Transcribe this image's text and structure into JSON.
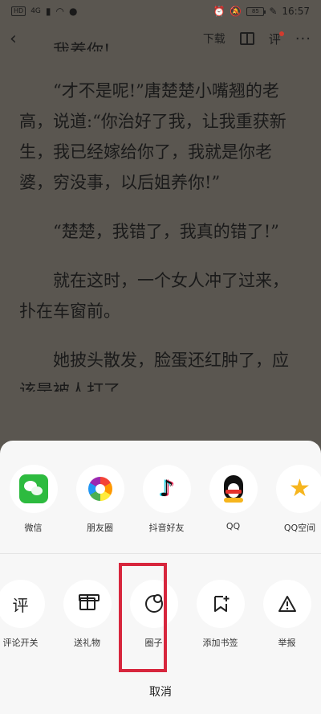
{
  "status_bar": {
    "left_badge": "HD",
    "signal": "4G",
    "battery": "85",
    "time": "16:57"
  },
  "toolbar": {
    "download_label": "下载",
    "comment_label": "评"
  },
  "content": {
    "top_fragment": "我养你!",
    "paragraphs": [
      "“才不是呢!”唐楚楚小嘴翘的老高，说道:“你治好了我，让我重获新生，我已经嫁给你了，我就是你老婆，穷没事，以后姐养你!”",
      "“楚楚，我错了，我真的错了!”",
      "就在这时，一个女人冲了过来，扑在车窗前。",
      "她披头散发，脸蛋还红肿了，应"
    ],
    "bottom_fragment": "该是被人打了。"
  },
  "share_row": [
    {
      "label": "微信",
      "icon": "wechat-icon"
    },
    {
      "label": "朋友圈",
      "icon": "moments-icon"
    },
    {
      "label": "抖音好友",
      "icon": "douyin-icon"
    },
    {
      "label": "QQ",
      "icon": "qq-icon"
    },
    {
      "label": "QQ空间",
      "icon": "qzone-icon"
    }
  ],
  "action_row": [
    {
      "label": "评论开关",
      "icon": "comment-toggle-icon"
    },
    {
      "label": "送礼物",
      "icon": "gift-icon"
    },
    {
      "label": "圈子",
      "icon": "circle-icon"
    },
    {
      "label": "添加书签",
      "icon": "bookmark-add-icon"
    },
    {
      "label": "举报",
      "icon": "report-icon"
    }
  ],
  "cancel_label": "取消",
  "colors": {
    "dim_background": "#5a5650",
    "sheet": "#f7f7f7",
    "highlight": "#d7263d",
    "badge_red": "#d23b2e"
  }
}
